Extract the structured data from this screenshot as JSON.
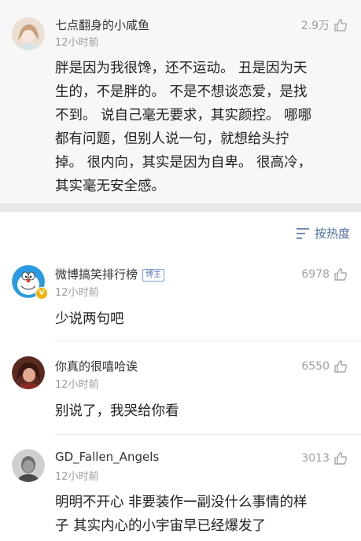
{
  "post": {
    "username": "七点翻身的小咸鱼",
    "time": "12小时前",
    "likes": "2.9万",
    "lines": [
      "胖是因为我很馋，还不运动。 丑是因为天",
      "生的，不是胖的。 不是不想谈恋爱，是找",
      "不到。 说自己毫无要求，其实颜控。 哪哪",
      "都有问题，但别人说一句，就想给头拧",
      "掉。 很内向，其实是因为自卑。 很高冷，",
      "其实毫无安全感。"
    ]
  },
  "sort": {
    "label": "按热度",
    "icon": "sort-lines-icon"
  },
  "comments": [
    {
      "username": "微博搞笑排行榜",
      "badge": "博主",
      "time": "12小时前",
      "likes": "6978",
      "lines": [
        "少说两句吧"
      ]
    },
    {
      "username": "你真的很嘻哈诶",
      "time": "12小时前",
      "likes": "6550",
      "lines": [
        "别说了，我哭给你看"
      ]
    },
    {
      "username": "GD_Fallen_Angels",
      "time": "12小时前",
      "likes": "3013",
      "lines": [
        "明明不开心 非要装作一副没什么事情的样",
        "子 其实内心的小宇宙早已经爆发了"
      ]
    }
  ],
  "colors": {
    "link_blue": "#4c6f9e",
    "muted": "#9a9a9a",
    "post_bg": "#f7f7f7"
  }
}
